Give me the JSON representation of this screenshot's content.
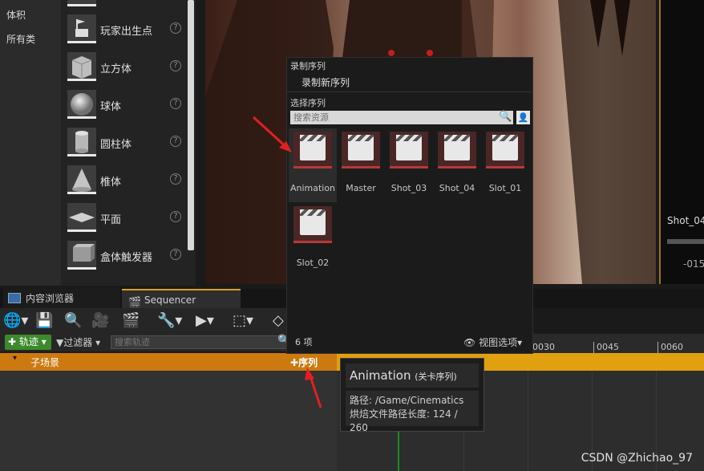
{
  "categories": [
    "体积",
    "所有类"
  ],
  "actors": [
    {
      "label": "玩家出生点",
      "icon": "player-start-icon"
    },
    {
      "label": "立方体",
      "icon": "cube-icon"
    },
    {
      "label": "球体",
      "icon": "sphere-icon"
    },
    {
      "label": "圆柱体",
      "icon": "cylinder-icon"
    },
    {
      "label": "椎体",
      "icon": "cone-icon"
    },
    {
      "label": "平面",
      "icon": "plane-icon"
    },
    {
      "label": "盒体触发器",
      "icon": "box-trigger-icon"
    }
  ],
  "help_glyph": "?",
  "tabs": [
    {
      "label": "内容浏览器",
      "icon": "content-browser-icon"
    },
    {
      "label": "Sequencer",
      "icon": "sequencer-icon"
    }
  ],
  "filter": {
    "track_button": "轨迹",
    "filter_label": "过滤器",
    "search_placeholder": "搜索轨迹"
  },
  "sequence_row": {
    "label": "子场景",
    "add_button": "序列"
  },
  "timeline": {
    "ticks": [
      "0030",
      "0045",
      "0060"
    ]
  },
  "preview": {
    "shot_label": "Shot_04",
    "time": "-015"
  },
  "popup": {
    "record_header": "录制序列",
    "record_item": "录制新序列",
    "select_header": "选择序列",
    "search_placeholder": "搜索资源",
    "assets": [
      "Animation",
      "Master",
      "Shot_03",
      "Shot_04",
      "Slot_01",
      "Slot_02"
    ],
    "count": "6 项",
    "view_options": "视图选项"
  },
  "tooltip": {
    "name": "Animation",
    "type": "(关卡序列)",
    "path_label": "路径:",
    "path": "/Game/Cinematics",
    "length_label": "烘焙文件路径长度:",
    "length": "124 / 260"
  },
  "watermark": "CSDN @Zhichao_97",
  "colors": {
    "accent_orange": "#cc7a10",
    "accent_yellow": "#e0a010",
    "green_button": "#3c8a2c",
    "arrow_red": "#e02020"
  }
}
